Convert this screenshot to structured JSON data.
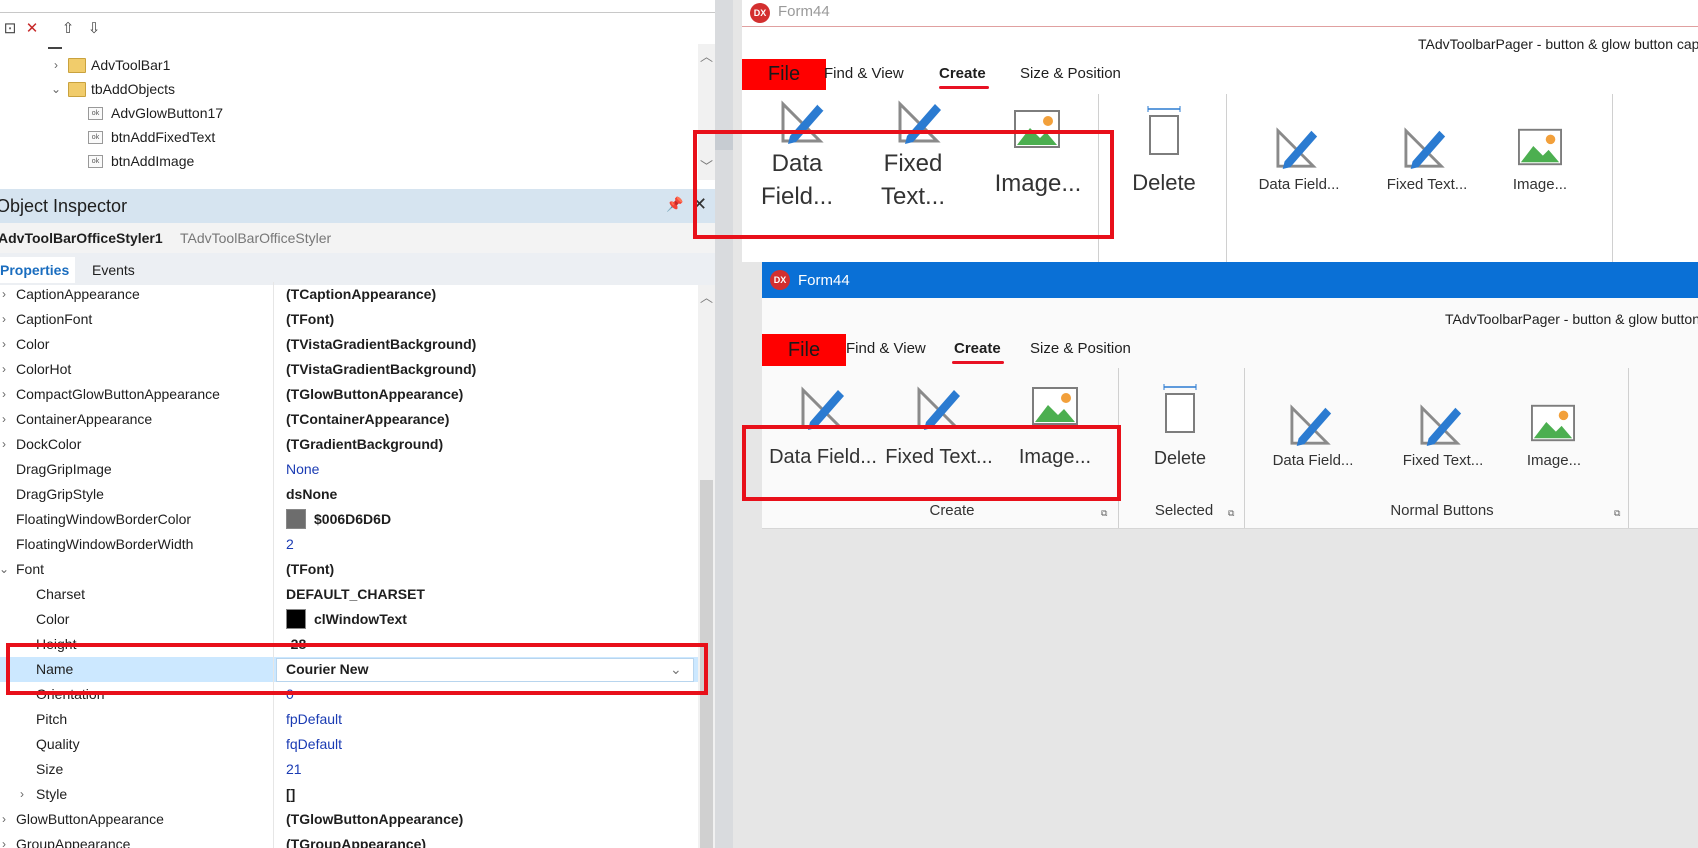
{
  "tree": {
    "items": [
      {
        "label": "AdvToolBar1",
        "kind": "folder",
        "expanded": false
      },
      {
        "label": "tbAddObjects",
        "kind": "folder",
        "expanded": true
      },
      {
        "label": "AdvGlowButton17",
        "kind": "button"
      },
      {
        "label": "btnAddFixedText",
        "kind": "button"
      },
      {
        "label": "btnAddImage",
        "kind": "button"
      }
    ]
  },
  "inspector": {
    "title": "Object Inspector",
    "object_name": "AdvToolBarOfficeStyler1",
    "object_type": "TAdvToolBarOfficeStyler",
    "tabs": [
      "Properties",
      "Events"
    ],
    "active_tab": "Properties",
    "properties": [
      {
        "name": "CaptionAppearance",
        "value": "(TCaptionAppearance)",
        "style": "bold",
        "indent": 0,
        "exp": "collapsed"
      },
      {
        "name": "CaptionFont",
        "value": "(TFont)",
        "style": "bold",
        "indent": 0,
        "exp": "collapsed"
      },
      {
        "name": "Color",
        "value": "(TVistaGradientBackground)",
        "style": "bold",
        "indent": 0,
        "exp": "collapsed"
      },
      {
        "name": "ColorHot",
        "value": "(TVistaGradientBackground)",
        "style": "bold",
        "indent": 0,
        "exp": "collapsed"
      },
      {
        "name": "CompactGlowButtonAppearance",
        "value": "(TGlowButtonAppearance)",
        "style": "bold",
        "indent": 0,
        "exp": "collapsed"
      },
      {
        "name": "ContainerAppearance",
        "value": "(TContainerAppearance)",
        "style": "bold",
        "indent": 0,
        "exp": "collapsed"
      },
      {
        "name": "DockColor",
        "value": "(TGradientBackground)",
        "style": "bold",
        "indent": 0,
        "exp": "collapsed"
      },
      {
        "name": "DragGripImage",
        "value": "None",
        "style": "blue",
        "indent": 0,
        "exp": "none"
      },
      {
        "name": "DragGripStyle",
        "value": "dsNone",
        "style": "bold",
        "indent": 0,
        "exp": "none"
      },
      {
        "name": "FloatingWindowBorderColor",
        "value": "$006D6D6D",
        "style": "bold",
        "indent": 0,
        "exp": "none",
        "swatch": "#6d6d6d"
      },
      {
        "name": "FloatingWindowBorderWidth",
        "value": "2",
        "style": "blue",
        "indent": 0,
        "exp": "none"
      },
      {
        "name": "Font",
        "value": "(TFont)",
        "style": "bold",
        "indent": 0,
        "exp": "expanded"
      },
      {
        "name": "Charset",
        "value": "DEFAULT_CHARSET",
        "style": "bold",
        "indent": 1,
        "exp": "none"
      },
      {
        "name": "Color",
        "value": "clWindowText",
        "style": "bold",
        "indent": 1,
        "exp": "none",
        "swatch": "#000000"
      },
      {
        "name": "Height",
        "value": "-28",
        "style": "bold",
        "indent": 1,
        "exp": "none"
      },
      {
        "name": "Name",
        "value": "Courier New",
        "style": "bold",
        "indent": 1,
        "exp": "none",
        "selected": true,
        "dropdown": true
      },
      {
        "name": "Orientation",
        "value": "0",
        "style": "blue",
        "indent": 1,
        "exp": "none"
      },
      {
        "name": "Pitch",
        "value": "fpDefault",
        "style": "blue",
        "indent": 1,
        "exp": "none"
      },
      {
        "name": "Quality",
        "value": "fqDefault",
        "style": "blue",
        "indent": 1,
        "exp": "none"
      },
      {
        "name": "Size",
        "value": "21",
        "style": "blue",
        "indent": 1,
        "exp": "none"
      },
      {
        "name": "Style",
        "value": "[]",
        "style": "bold",
        "indent": 1,
        "exp": "collapsed"
      },
      {
        "name": "GlowButtonAppearance",
        "value": "(TGlowButtonAppearance)",
        "style": "bold",
        "indent": 0,
        "exp": "collapsed"
      },
      {
        "name": "GroupAppearance",
        "value": "(TGroupAppearance)",
        "style": "bold",
        "indent": 0,
        "exp": "collapsed"
      }
    ]
  },
  "form_back": {
    "title": "Form44",
    "caption": "TAdvToolbarPager - button & glow button cap",
    "tabs": {
      "file": "File",
      "find": "Find & View",
      "create": "Create",
      "size": "Size & Position"
    },
    "buttons": {
      "data_field_l1": "Data",
      "data_field_l2": "Field...",
      "fixed_text_l1": "Fixed",
      "fixed_text_l2": "Text...",
      "image": "Image...",
      "delete": "Delete",
      "data_field_small": "Data Field...",
      "fixed_text_small": "Fixed Text...",
      "image_small": "Image..."
    }
  },
  "form_front": {
    "title": "Form44",
    "caption": "TAdvToolbarPager - button & glow button",
    "tabs": {
      "file": "File",
      "find": "Find & View",
      "create": "Create",
      "size": "Size & Position"
    },
    "buttons": {
      "data_field": "Data Field...",
      "fixed_text": "Fixed Text...",
      "image": "Image...",
      "delete": "Delete",
      "data_field_small": "Data Field...",
      "fixed_text_small": "Fixed Text...",
      "image_small": "Image..."
    },
    "groups": {
      "create": "Create",
      "selected": "Selected",
      "normal": "Normal Buttons"
    }
  },
  "colors": {
    "accent": "#0078d7",
    "highlight_box": "#e8101a",
    "file_tab": "#ff0000",
    "selection": "#cce8ff"
  }
}
